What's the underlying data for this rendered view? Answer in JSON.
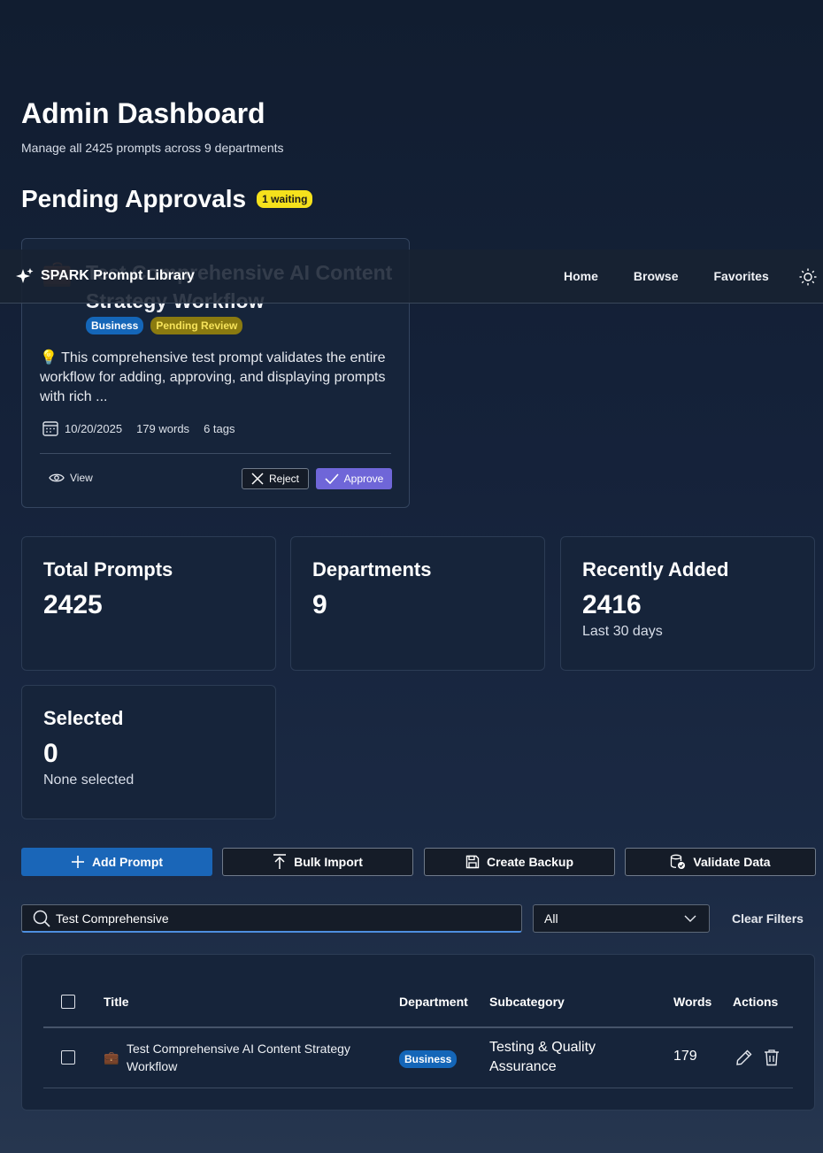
{
  "header": {
    "title": "Admin Dashboard",
    "subtitle": "Manage all 2425 prompts across 9 departments"
  },
  "pending": {
    "section_title": "Pending Approvals",
    "badge": "1 waiting",
    "card": {
      "icon": "briefcase-icon",
      "title": "Test Comprehensive AI Content Strategy Workflow",
      "department": "Business",
      "status": "Pending Review",
      "description": "💡 This comprehensive test prompt validates the entire workflow for adding, approving, and displaying prompts with rich ...",
      "date": "10/20/2025",
      "words": "179 words",
      "tags": "6 tags",
      "view_label": "View",
      "reject_label": "Reject",
      "approve_label": "Approve"
    }
  },
  "nav": {
    "brand": "SPARK Prompt Library",
    "links": [
      "Home",
      "Browse",
      "Favorites"
    ],
    "theme_icon": "sun-icon"
  },
  "stats": [
    {
      "label": "Total Prompts",
      "value": "2425",
      "sub": ""
    },
    {
      "label": "Departments",
      "value": "9",
      "sub": ""
    },
    {
      "label": "Recently Added",
      "value": "2416",
      "sub": "Last 30 days"
    },
    {
      "label": "Selected",
      "value": "0",
      "sub": "None selected"
    }
  ],
  "actions": {
    "add": "Add Prompt",
    "import": "Bulk Import",
    "backup": "Create Backup",
    "validate": "Validate Data"
  },
  "filters": {
    "search_value": "Test Comprehensive",
    "department_selected": "All",
    "clear_label": "Clear Filters"
  },
  "table": {
    "columns": [
      "Title",
      "Department",
      "Subcategory",
      "Words",
      "Actions"
    ],
    "rows": [
      {
        "title": "Test Comprehensive AI Content Strategy Workflow",
        "department": "Business",
        "subcategory": "Testing & Quality Assurance",
        "words": "179"
      }
    ]
  },
  "colors": {
    "accent_primary": "#1a66b8",
    "approve": "#6f66d8",
    "badge_waiting": "#f5e11c",
    "pending_tag": "#8a7a10"
  }
}
